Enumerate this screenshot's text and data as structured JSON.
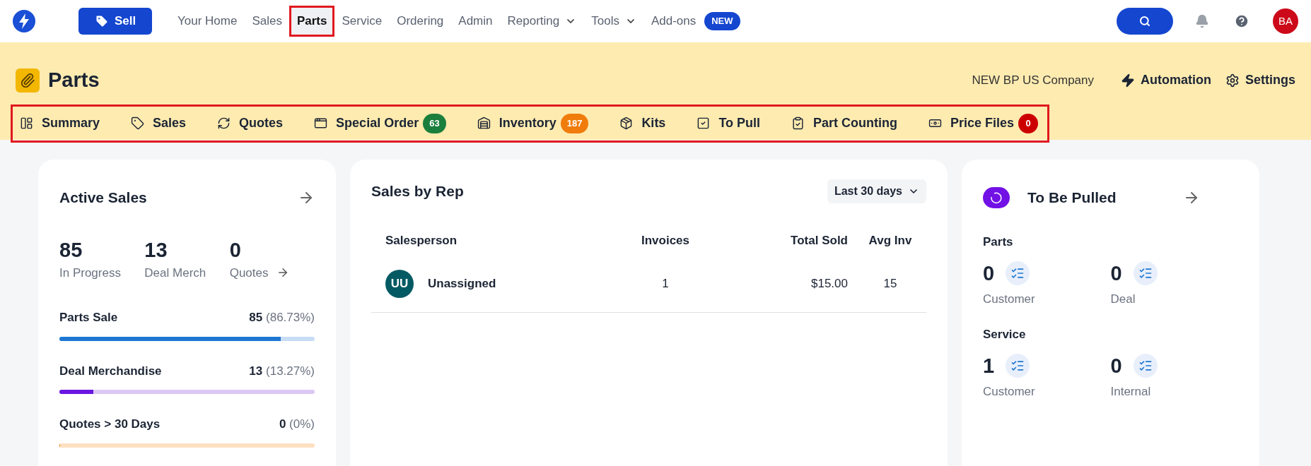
{
  "top_nav": {
    "sell_button": "Sell",
    "items": [
      {
        "label": "Your Home",
        "selected": false,
        "has_menu": false
      },
      {
        "label": "Sales",
        "selected": false,
        "has_menu": false
      },
      {
        "label": "Parts",
        "selected": true,
        "has_menu": false
      },
      {
        "label": "Service",
        "selected": false,
        "has_menu": false
      },
      {
        "label": "Ordering",
        "selected": false,
        "has_menu": false
      },
      {
        "label": "Admin",
        "selected": false,
        "has_menu": false
      },
      {
        "label": "Reporting",
        "selected": false,
        "has_menu": true
      },
      {
        "label": "Tools",
        "selected": false,
        "has_menu": true
      },
      {
        "label": "Add-ons",
        "selected": false,
        "has_menu": false,
        "badge": "NEW"
      }
    ],
    "avatar": "BA"
  },
  "header": {
    "title": "Parts",
    "company": "NEW BP US Company",
    "actions": [
      {
        "kind": "automation",
        "label": "Automation"
      },
      {
        "kind": "settings",
        "label": "Settings"
      }
    ]
  },
  "tabs": [
    {
      "kind": "summary",
      "label": "Summary"
    },
    {
      "kind": "sales",
      "label": "Sales"
    },
    {
      "kind": "quotes",
      "label": "Quotes"
    },
    {
      "kind": "special",
      "label": "Special Order",
      "badge": "63",
      "color": "#1a7f3c"
    },
    {
      "kind": "inventory",
      "label": "Inventory",
      "badge": "187",
      "color": "#f07c0c"
    },
    {
      "kind": "kits",
      "label": "Kits"
    },
    {
      "kind": "pull",
      "label": "To Pull"
    },
    {
      "kind": "counting",
      "label": "Part Counting"
    },
    {
      "kind": "price",
      "label": "Price Files",
      "badge": "0",
      "color": "#cc0000"
    }
  ],
  "active_sales": {
    "title": "Active Sales",
    "stats": [
      {
        "value": "85",
        "label": "In Progress",
        "link": false
      },
      {
        "value": "13",
        "label": "Deal Merch",
        "link": false
      },
      {
        "value": "0",
        "label": "Quotes",
        "link": true
      }
    ],
    "bars": [
      {
        "label": "Parts Sale",
        "count": "85",
        "percent": "(86.73%)",
        "level": 0.8673,
        "kind": "parts"
      },
      {
        "label": "Deal Merchandise",
        "count": "13",
        "percent": "(13.27%)",
        "level": 0.1327,
        "kind": "deal"
      },
      {
        "label": "Quotes > 30 Days",
        "count": "0",
        "percent": "(0%)",
        "level": 0,
        "kind": "quotes"
      }
    ]
  },
  "sales_by_rep": {
    "title": "Sales by Rep",
    "range": "Last 30 days",
    "columns": [
      "Salesperson",
      "Invoices",
      "Total Sold",
      "Avg Inv"
    ],
    "rows": [
      {
        "initials": "UU",
        "name": "Unassigned",
        "invoices": "1",
        "total": "$15.00",
        "avg": "15"
      }
    ]
  },
  "to_be_pulled": {
    "title": "To Be Pulled",
    "groups": [
      {
        "title": "Parts",
        "items": [
          {
            "value": "0",
            "label": "Customer"
          },
          {
            "value": "0",
            "label": "Deal"
          }
        ]
      },
      {
        "title": "Service",
        "items": [
          {
            "value": "1",
            "label": "Customer"
          },
          {
            "value": "0",
            "label": "Internal"
          }
        ]
      }
    ]
  }
}
